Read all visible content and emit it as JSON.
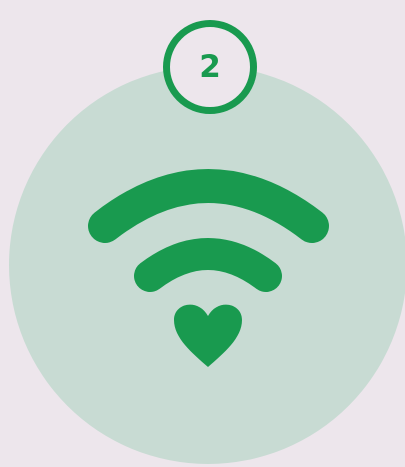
{
  "step": {
    "number": "2"
  },
  "illustration": {
    "icons": [
      "wifi-icon",
      "heart-icon"
    ]
  },
  "colors": {
    "background": "#ede6ec",
    "circle": "#c8dbd3",
    "accent": "#199a4f"
  }
}
